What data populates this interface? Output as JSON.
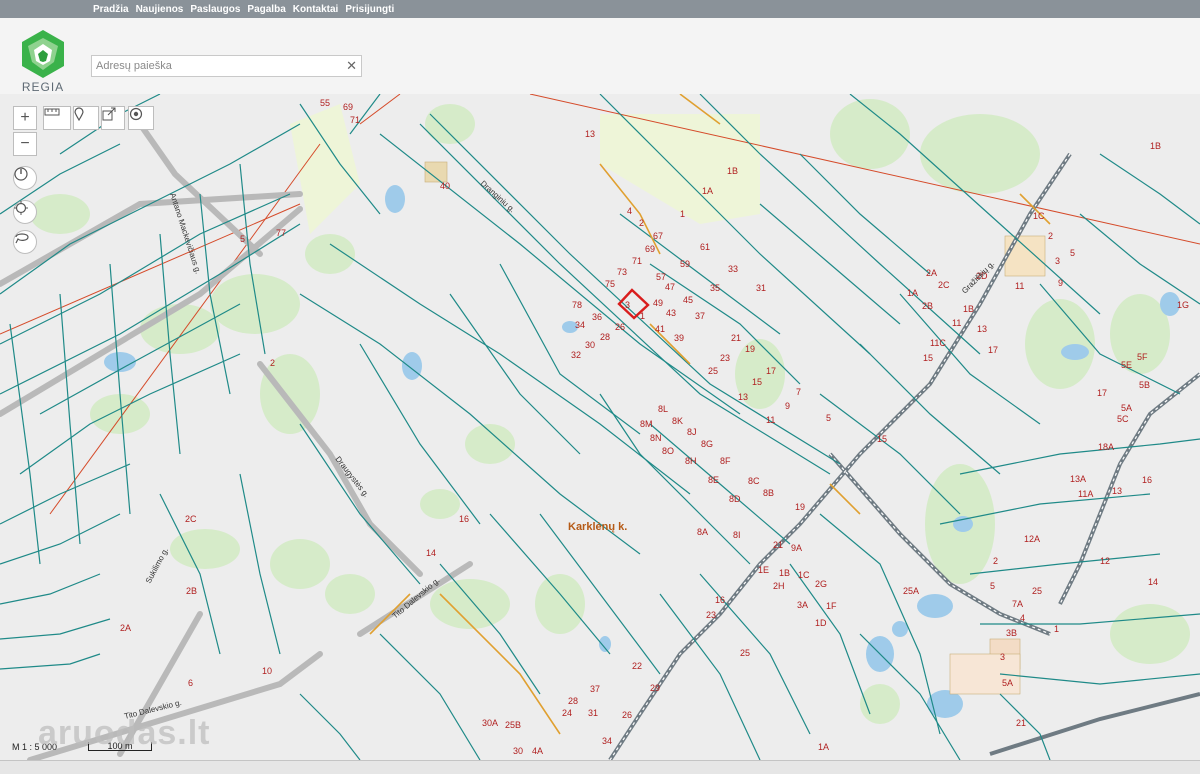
{
  "nav": [
    "Pradžia",
    "Naujienos",
    "Paslaugos",
    "Pagalba",
    "Kontaktai",
    "Prisijungti"
  ],
  "logo_text": "REGIA",
  "search": {
    "placeholder": "Adresų paieška",
    "value": "",
    "clear_glyph": "✕"
  },
  "controls": [
    {
      "name": "zoom-in-button",
      "icon": "plus-icon"
    },
    {
      "name": "zoom-out-button",
      "icon": "minus-icon"
    },
    {
      "name": "rotate-north-button",
      "icon": "compass-icon"
    },
    {
      "name": "locate-button",
      "icon": "crosshair-icon"
    },
    {
      "name": "lasso-button",
      "icon": "lasso-icon"
    },
    {
      "name": "measure-ruler-button",
      "icon": "ruler-icon"
    },
    {
      "name": "marker-button",
      "icon": "marker-icon"
    },
    {
      "name": "share-button",
      "icon": "share-icon"
    },
    {
      "name": "target-button",
      "icon": "target-icon"
    }
  ],
  "map": {
    "place_label": "Karklėnų k.",
    "streets": [
      "Antano Mackevičiaus g.",
      "Dranginiu g.",
      "Sukilimo g.",
      "Tito Dalevskio g.",
      "Tito Dalevskio g.",
      "Draugystės g.",
      "Gražiškių g."
    ],
    "parcel_numbers": [
      "13",
      "1B",
      "1A",
      "1",
      "4",
      "2",
      "67",
      "69",
      "71",
      "61",
      "59",
      "33",
      "73",
      "75",
      "57",
      "47",
      "45",
      "35",
      "31",
      "49",
      "43",
      "37",
      "3",
      "1",
      "21",
      "19",
      "15",
      "17",
      "7",
      "5",
      "78",
      "36",
      "26",
      "34",
      "30",
      "28",
      "32",
      "41",
      "39",
      "25",
      "23",
      "13",
      "11",
      "9",
      "8L",
      "8K",
      "8J",
      "8M",
      "8N",
      "8O",
      "8G",
      "8H",
      "8F",
      "8E",
      "8C",
      "8B",
      "8D",
      "8A",
      "8I",
      "40",
      "55",
      "69",
      "71",
      "5",
      "77",
      "2",
      "2C",
      "2B",
      "2A",
      "6",
      "10",
      "14",
      "16",
      "19",
      "21",
      "9A",
      "1B",
      "1C",
      "2G",
      "2H",
      "1E",
      "1D",
      "1F",
      "3A",
      "25A",
      "25",
      "23",
      "16",
      "22",
      "37",
      "29",
      "26",
      "28",
      "24",
      "31",
      "34",
      "30",
      "4A",
      "30A",
      "25B",
      "1A",
      "1B",
      "1C",
      "2",
      "3",
      "5",
      "9",
      "11",
      "2D",
      "2B",
      "2A",
      "2C",
      "1A",
      "1B",
      "11",
      "13",
      "15",
      "11C",
      "17",
      "15",
      "18A",
      "16",
      "13",
      "13A",
      "11A",
      "12A",
      "12",
      "14",
      "2",
      "5",
      "7A",
      "25",
      "3B",
      "3",
      "5A",
      "4",
      "1",
      "21",
      "1G",
      "5F",
      "5E",
      "5B",
      "5A",
      "5C",
      "17"
    ],
    "scale_text": "M 1 : 5 000",
    "scalebar_text": "100 m",
    "watermark": "aruodas.lt"
  }
}
